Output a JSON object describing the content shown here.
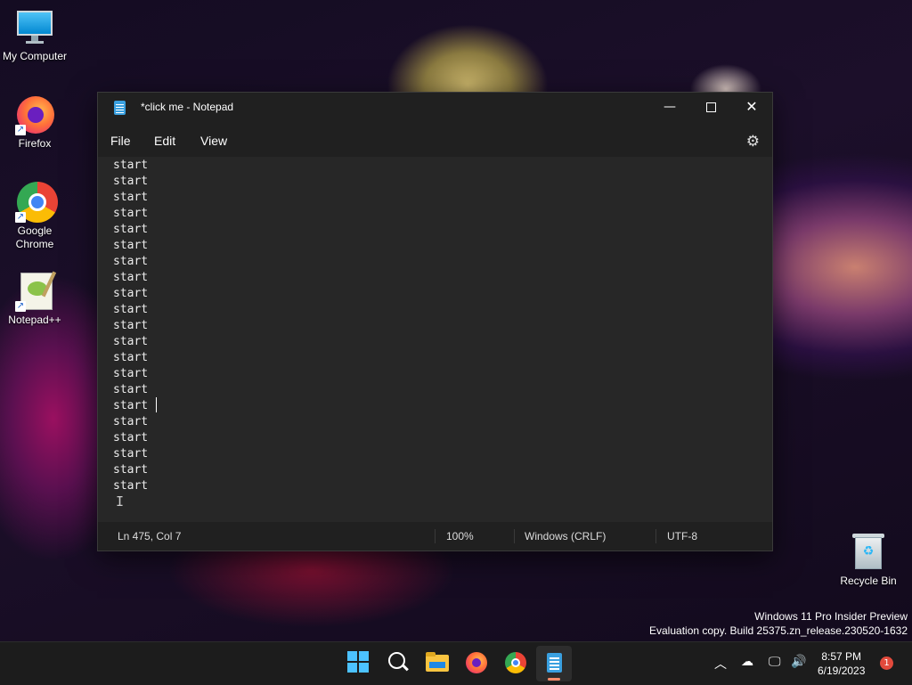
{
  "desktop": {
    "icons": [
      {
        "label": "My Computer"
      },
      {
        "label": "Firefox"
      },
      {
        "label": "Google Chrome"
      },
      {
        "label": "Notepad++"
      },
      {
        "label": "Recycle Bin"
      }
    ]
  },
  "window": {
    "title": "*click me - Notepad",
    "menu": [
      "File",
      "Edit",
      "View"
    ],
    "lines": [
      "start",
      "start",
      "start",
      "start",
      "start",
      "start",
      "start",
      "start",
      "start",
      "start",
      "start",
      "start",
      "start",
      "start",
      "start",
      "start",
      "start",
      "start",
      "start",
      "start",
      "start"
    ],
    "status": {
      "position": "Ln 475, Col 7",
      "zoom": "100%",
      "line_ending": "Windows (CRLF)",
      "encoding": "UTF-8"
    }
  },
  "watermark": {
    "line1": "Windows 11 Pro Insider Preview",
    "line2": "Evaluation copy. Build 25375.zn_release.230520-1632"
  },
  "taskbar": {
    "time": "8:57 PM",
    "date": "6/19/2023",
    "notifications": "1"
  },
  "colors": {
    "accent": "#3aa0e0",
    "notification": "#e24a3c"
  }
}
